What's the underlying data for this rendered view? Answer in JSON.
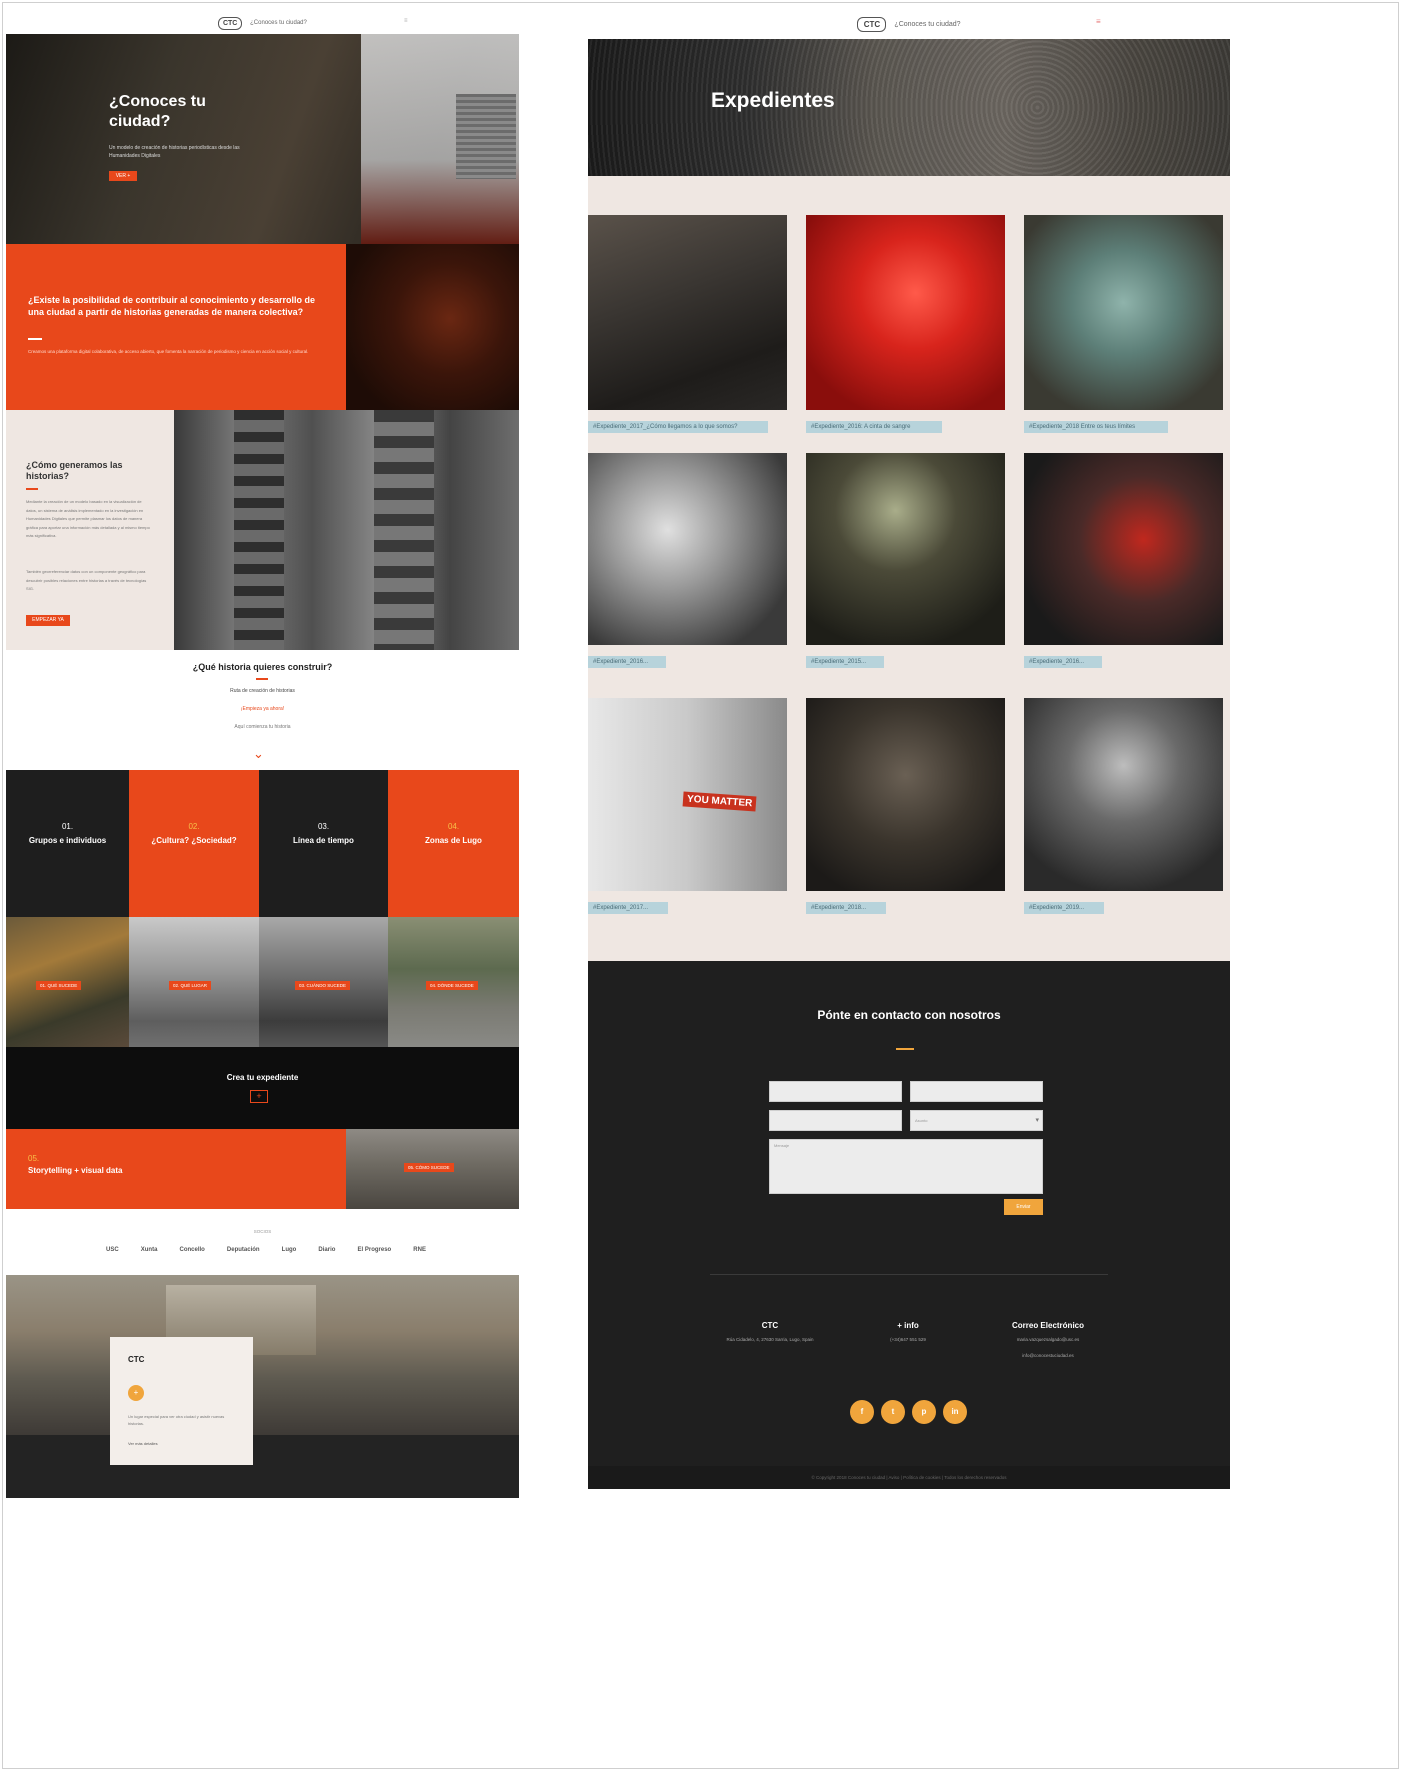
{
  "left": {
    "header": {
      "logo": "CTC",
      "site_name": "¿Conoces tu ciudad?",
      "menu_icon": "hamburger-icon"
    },
    "hero": {
      "title": "¿Conoces tu ciudad?",
      "subtitle": "Un modelo de creación de historias periodísticas desde las Humanidades Digitales",
      "button": "VER +"
    },
    "question": {
      "title": "¿Existe la posibilidad de contribuir al conocimiento y desarrollo de una ciudad a partir de historias generadas de manera colectiva?",
      "body": "Creamos una plataforma digital colaborativa, de acceso abierto, que fomenta la narración de periodismo y ciencia en acción social y cultural."
    },
    "how": {
      "title": "¿Cómo generamos las historias?",
      "p1": "Mediante la creación de un modelo basado en la visualización de datos, un sistema de análisis implementado en la investigación en Humanidades Digitales que permite plasmar los datos de manera gráfica para aportar una información más detallada y al mismo tiempo más significativa.",
      "p2": "También georreferenciar datos con un componente geográfico para descubrir posibles relaciones entre historias a través de tecnologías SIG.",
      "button": "EMPEZAR YA"
    },
    "build": {
      "title": "¿Qué historia quieres construir?",
      "line1": "Ruta de creación de historias",
      "link": "¡Empieza ya ahora!",
      "line3": "Aquí comienza tu historia"
    },
    "steps": [
      {
        "num": "01.",
        "label": "Grupos e individuos",
        "tag": "01. QUÉ SUCEDE"
      },
      {
        "num": "02.",
        "label": "¿Cultura? ¿Sociedad?",
        "tag": "02. QUÉ LUGAR"
      },
      {
        "num": "03.",
        "label": "Línea de tiempo",
        "tag": "03. CUÁNDO SUCEDE"
      },
      {
        "num": "04.",
        "label": "Zonas de Lugo",
        "tag": "04. DÓNDE SUCEDE"
      }
    ],
    "create": {
      "label": "Crea tu expediente",
      "icon": "plus-icon"
    },
    "step5": {
      "num": "05.",
      "label": "Storytelling + visual data",
      "tag": "05. CÓMO SUCEDE"
    },
    "partners": {
      "label": "SOCIOS",
      "logos": [
        "USC",
        "Xunta",
        "Concello",
        "Deputación",
        "Lugo",
        "Diario",
        "El Progreso",
        "RNE"
      ]
    },
    "ctc_card": {
      "title": "CTC",
      "badge": "+",
      "text": "Un lugar especial para ver otra ciudad y asistir nuevas historias.",
      "link": "Ver más detalles"
    }
  },
  "right": {
    "header": {
      "logo": "CTC",
      "site_name": "¿Conoces tu ciudad?",
      "menu_icon": "hamburger-icon"
    },
    "banner_title": "Expedientes",
    "captions": [
      "#Expediente_2017_¿Cómo llegamos a lo que somos?",
      "#Expediente_2016: A cinta de sangre",
      "#Expediente_2018 Entre os teus límites",
      "#Expediente_2016...",
      "#Expediente_2015...",
      "#Expediente_2016...",
      "#Expediente_2017...",
      "#Expediente_2018...",
      "#Expediente_2019..."
    ],
    "shirt_text": "YOU MATTER",
    "contact": {
      "title": "Pónte en contacto con nosotros",
      "select_placeholder": "Asunto",
      "message_placeholder": "Mensaje",
      "send_button": "Enviar"
    },
    "footer": {
      "col1_title": "CTC",
      "col1_text": "Rúa Cidadelo, 4, 27630 Sarria, Lugo, Spain",
      "col2_title": "+ info",
      "col2_text": "(+34)647 551 529",
      "col3_title": "Correo Electrónico",
      "col3_line1": "maria.vazquezsalgado@usc.es",
      "col3_line2": "info@conocestuciudad.es",
      "socials": [
        "f",
        "t",
        "p",
        "in"
      ],
      "copyright": "© Copyright 2018 Conoces tu ciudad | Aviso | Política de cookies | Todos los derechos reservados"
    }
  }
}
